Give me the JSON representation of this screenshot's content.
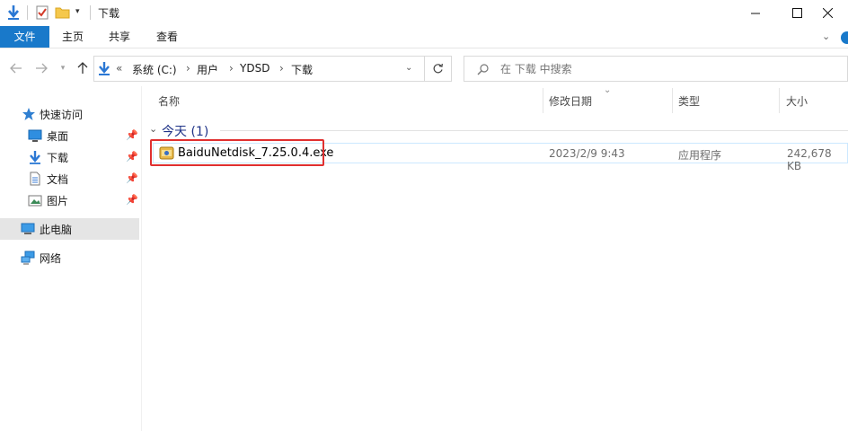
{
  "window": {
    "title": "下载"
  },
  "ribbon": {
    "tabs": [
      "文件",
      "主页",
      "共享",
      "查看"
    ]
  },
  "address": {
    "overflow": "«",
    "crumbs": [
      "系统 (C:)",
      "用户",
      "YDSD",
      "下载"
    ],
    "separator": "›"
  },
  "search": {
    "placeholder": "在 下载 中搜索"
  },
  "sidebar": {
    "items": [
      {
        "label": "快速访问",
        "icon": "star-icon"
      },
      {
        "label": "桌面",
        "icon": "desktop-icon",
        "pinned": true
      },
      {
        "label": "下载",
        "icon": "download-icon",
        "pinned": true
      },
      {
        "label": "文档",
        "icon": "document-icon",
        "pinned": true
      },
      {
        "label": "图片",
        "icon": "picture-icon",
        "pinned": true
      },
      {
        "label": "此电脑",
        "icon": "computer-icon",
        "selected": true
      },
      {
        "label": "网络",
        "icon": "network-icon"
      }
    ]
  },
  "columns": {
    "name": "名称",
    "date": "修改日期",
    "type": "类型",
    "size": "大小"
  },
  "group": {
    "title": "今天 (1)"
  },
  "files": [
    {
      "name": "BaiduNetdisk_7.25.0.4.exe",
      "date": "2023/2/9 9:43",
      "type": "应用程序",
      "size": "242,678 KB"
    }
  ],
  "colors": {
    "accent": "#1979ca",
    "highlight": "#e03030",
    "group_title": "#1e3287"
  }
}
